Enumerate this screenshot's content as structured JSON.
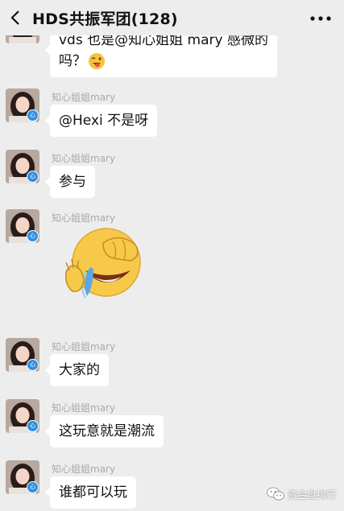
{
  "header": {
    "title": "HDS共振军团(128)"
  },
  "messages": [
    {
      "type": "text",
      "sender": "",
      "lines": [
        "vds 也是@知心姐姐 mary  感微的",
        "吗？"
      ],
      "emoji_inline": "tongue-wink-emoji"
    },
    {
      "type": "text",
      "sender": "知心姐姐mary",
      "text": "@Hexi  不是呀"
    },
    {
      "type": "text",
      "sender": "知心姐姐mary",
      "text": "参与"
    },
    {
      "type": "sticker",
      "sender": "知心姐姐mary",
      "sticker": "facepalm-laugh-emoji"
    },
    {
      "type": "text",
      "sender": "知心姐姐mary",
      "text": "大家的"
    },
    {
      "type": "text",
      "sender": "知心姐姐mary",
      "text": "这玩意就是潮流"
    },
    {
      "type": "text",
      "sender": "知心姐姐mary",
      "text": "谁都可以玩"
    }
  ],
  "badge_glyph": "心",
  "watermark": {
    "text": "资金盘排行",
    "icon": "wechat-icon"
  }
}
